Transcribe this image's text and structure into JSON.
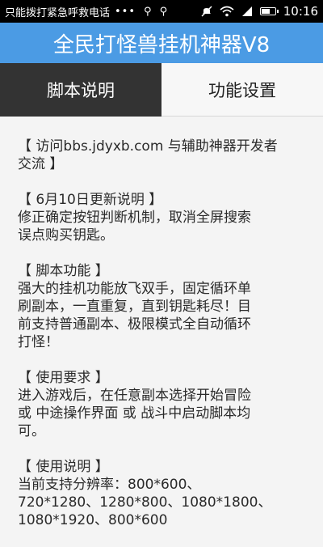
{
  "status_bar": {
    "carrier_text": "只能拨打紧急呼救电话",
    "dots": "•••",
    "time": "10:16",
    "icons": [
      "usb-icon",
      "usb-icon",
      "mute-icon",
      "wifi-icon",
      "signal-icon",
      "battery-icon"
    ],
    "battery_level": 0.7
  },
  "app": {
    "title": "全民打怪兽挂机神器V8"
  },
  "tabs": [
    {
      "label": "脚本说明",
      "active": true
    },
    {
      "label": "功能设置",
      "active": false
    }
  ],
  "content": {
    "sections": [
      {
        "lines": [
          "【 访问bbs.jdyxb.com 与辅助神器开发者",
          "交流 】"
        ]
      },
      {
        "lines": [
          "【 6月10日更新说明 】",
          "修正确定按钮判断机制，取消全屏搜索",
          "误点购买钥匙。"
        ]
      },
      {
        "lines": [
          "【 脚本功能 】",
          "强大的挂机功能放飞双手，固定循环单",
          "刷副本，一直重复，直到钥匙耗尽！目",
          "前支持普通副本、极限模式全自动循环",
          "打怪！"
        ]
      },
      {
        "lines": [
          "【 使用要求 】",
          "进入游戏后，在任意副本选择开始冒险",
          "或 中途操作界面 或 战斗中启动脚本均",
          "可。"
        ]
      },
      {
        "lines": [
          "【 使用说明 】",
          "当前支持分辨率：800*600、",
          "720*1280、1280*800、1080*1800、",
          "1080*1920、800*600"
        ]
      }
    ]
  }
}
